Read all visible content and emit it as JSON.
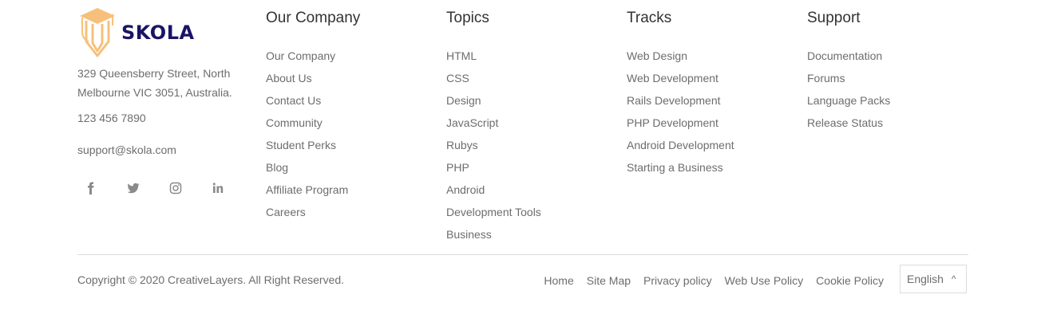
{
  "brand": {
    "name": "SKOLA",
    "logo_icon": "graduation-pencil-icon",
    "accent_color": "#f7c07a",
    "name_color": "#1b1464"
  },
  "contact": {
    "address_line1": "329 Queensberry Street, North",
    "address_line2": "Melbourne VIC 3051, Australia.",
    "phone": "123 456 7890",
    "email": "support@skola.com"
  },
  "social": [
    "facebook-icon",
    "twitter-icon",
    "instagram-icon",
    "linkedin-icon"
  ],
  "columns": [
    {
      "title": "Our Company",
      "items": [
        "Our Company",
        "About Us",
        "Contact Us",
        "Community",
        "Student Perks",
        "Blog",
        "Affiliate Program",
        "Careers"
      ]
    },
    {
      "title": "Topics",
      "items": [
        "HTML",
        "CSS",
        "Design",
        "JavaScript",
        "Rubys",
        "PHP",
        "Android",
        "Development Tools",
        "Business"
      ]
    },
    {
      "title": "Tracks",
      "items": [
        "Web Design",
        "Web Development",
        "Rails Development",
        "PHP Development",
        "Android Development",
        "Starting a Business"
      ]
    },
    {
      "title": "Support",
      "items": [
        "Documentation",
        "Forums",
        "Language Packs",
        "Release Status"
      ]
    }
  ],
  "footer": {
    "copyright": "Copyright © 2020 CreativeLayers. All Right Reserved.",
    "links": [
      "Home",
      "Site Map",
      "Privacy policy",
      "Web Use Policy",
      "Cookie Policy"
    ],
    "language": "English",
    "language_caret": "^"
  }
}
